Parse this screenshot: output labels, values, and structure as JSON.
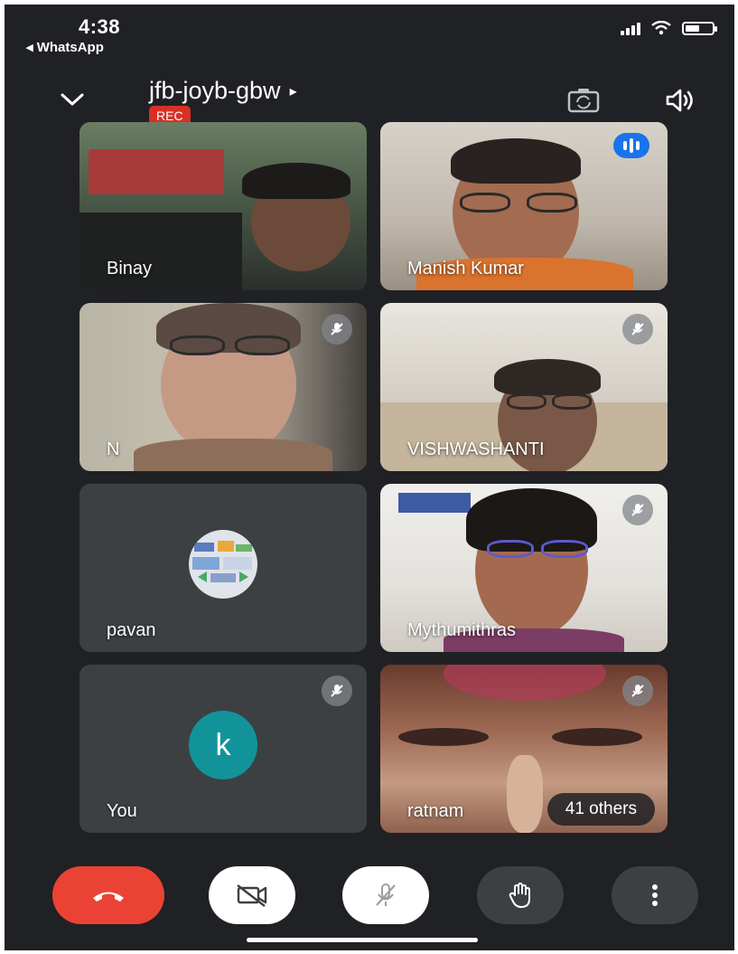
{
  "status_bar": {
    "time": "4:38",
    "back_app": "◂ WhatsApp",
    "battery_level": 0.55
  },
  "header": {
    "meeting_code": "jfb-joyb-gbw",
    "expand_glyph": "▸",
    "recording_badge": "REC"
  },
  "participants": [
    {
      "name": "Binay",
      "muted": false,
      "speaking": false
    },
    {
      "name": "Manish Kumar",
      "muted": false,
      "speaking": true
    },
    {
      "name": "N",
      "muted": true,
      "speaking": false
    },
    {
      "name": "VISHWASHANTI",
      "muted": true,
      "speaking": false
    },
    {
      "name": "pavan",
      "muted": false,
      "speaking": false,
      "avatar": "image"
    },
    {
      "name": "Mythumithras",
      "muted": true,
      "speaking": false
    },
    {
      "name": "You",
      "muted": true,
      "speaking": false,
      "avatar_letter": "k"
    },
    {
      "name": "ratnam",
      "muted": true,
      "speaking": false
    }
  ],
  "others_chip": "41 others",
  "controls": [
    {
      "name": "end-call",
      "icon": "phone-hangup-icon",
      "color": "#ea4335"
    },
    {
      "name": "camera-toggle",
      "icon": "video-off-icon",
      "color": "#ffffff"
    },
    {
      "name": "mic-toggle",
      "icon": "mic-off-icon",
      "color": "#ffffff"
    },
    {
      "name": "raise-hand",
      "icon": "hand-icon",
      "color": "#3c4043"
    },
    {
      "name": "more-options",
      "icon": "more-vert-icon",
      "color": "#3c4043"
    }
  ],
  "colors": {
    "background": "#202124",
    "tile": "#3c4043",
    "active_outline": "#8ab4f8",
    "speaking_indicator": "#1a73e8",
    "rec_badge": "#d93025",
    "avatar_k": "#12939a",
    "end_call": "#ea4335"
  }
}
